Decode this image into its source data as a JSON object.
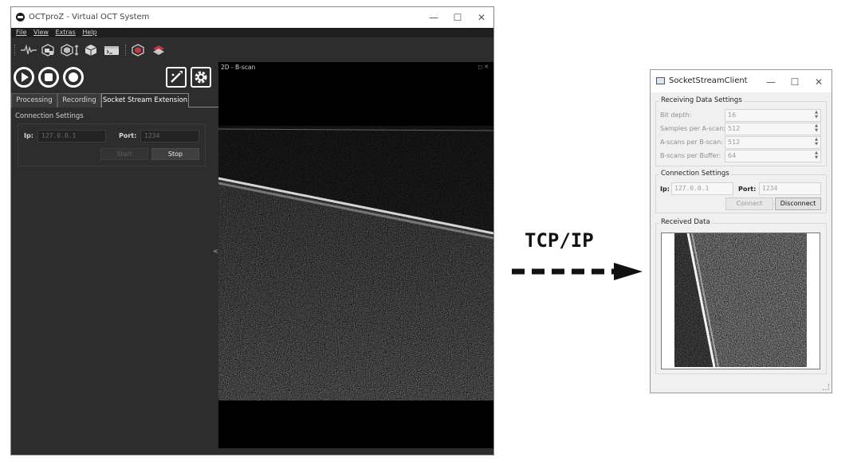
{
  "octproz": {
    "window_title": "OCTproZ - Virtual OCT System",
    "window_buttons": {
      "minimize": "—",
      "maximize": "☐",
      "close": "✕"
    },
    "menu": [
      "File",
      "View",
      "Extras",
      "Help"
    ],
    "tabs": [
      "Processing",
      "Recording",
      "Socket Stream Extension"
    ],
    "active_tab": "Socket Stream Extension",
    "connection": {
      "title": "Connection Settings",
      "ip_label": "Ip:",
      "ip_value": "127.0.0.1",
      "port_label": "Port:",
      "port_value": "1234",
      "start_label": "Start",
      "stop_label": "Stop"
    },
    "splitter_arrow": "<",
    "plot": {
      "title": "2D - B-scan",
      "dock_icons": "◻✕"
    }
  },
  "arrow": {
    "label": "TCP/IP"
  },
  "socket_client": {
    "window_title": "SocketStreamClient",
    "window_buttons": {
      "minimize": "—",
      "maximize": "☐",
      "close": "✕"
    },
    "receiving": {
      "title": "Receiving Data Settings",
      "rows": [
        {
          "label": "Bit depth:",
          "value": "16"
        },
        {
          "label": "Samples per A-scan:",
          "value": "512"
        },
        {
          "label": "A-scans per B-scan:",
          "value": "512"
        },
        {
          "label": "B-scans per Buffer:",
          "value": "64"
        }
      ]
    },
    "connection": {
      "title": "Connection Settings",
      "ip_label": "Ip:",
      "ip_value": "127.0.0.1",
      "port_label": "Port:",
      "port_value": "1234",
      "connect_label": "Connect",
      "disconnect_label": "Disconnect"
    },
    "received": {
      "title": "Received Data"
    }
  },
  "colors": {
    "dark_bg": "#2d2d2d",
    "light_bg": "#f0f0f0",
    "accent_icon": "#c0394b"
  }
}
